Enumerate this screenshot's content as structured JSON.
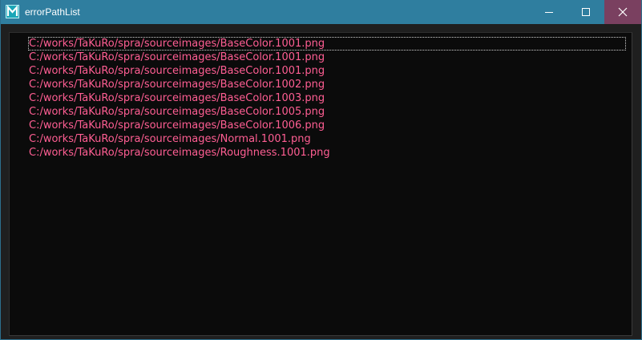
{
  "window": {
    "title": "errorPathList",
    "icon": "maya-logo-icon",
    "controls": [
      "minimize",
      "maximize",
      "close"
    ],
    "colors": {
      "titlebar": "#2f7e9f",
      "close_hover": "#7a4060",
      "list_background": "#0b0b0b",
      "item_text": "#ff5e93"
    }
  },
  "error_path_list": {
    "items": [
      "C:/works/TaKuRo/spra/sourceimages/BaseColor.1001.png",
      "C:/works/TaKuRo/spra/sourceimages/BaseColor.1001.png",
      "C:/works/TaKuRo/spra/sourceimages/BaseColor.1001.png",
      "C:/works/TaKuRo/spra/sourceimages/BaseColor.1002.png",
      "C:/works/TaKuRo/spra/sourceimages/BaseColor.1003.png",
      "C:/works/TaKuRo/spra/sourceimages/BaseColor.1005.png",
      "C:/works/TaKuRo/spra/sourceimages/BaseColor.1006.png",
      "C:/works/TaKuRo/spra/sourceimages/Normal.1001.png",
      "C:/works/TaKuRo/spra/sourceimages/Roughness.1001.png"
    ],
    "focused_index": 0
  }
}
